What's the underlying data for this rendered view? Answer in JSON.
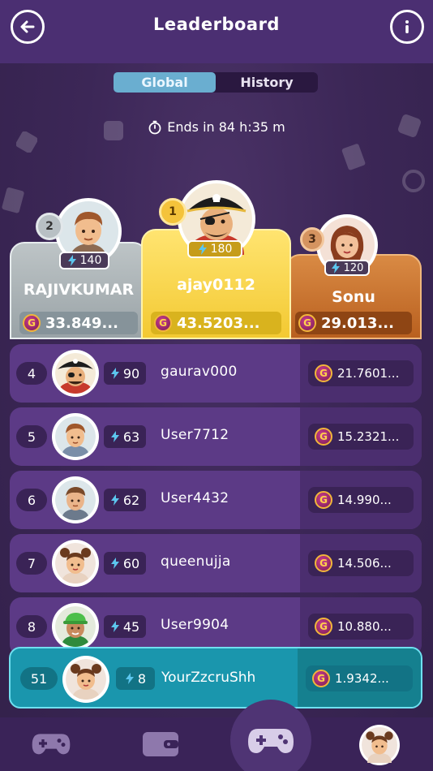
{
  "header": {
    "title": "Leaderboard"
  },
  "tabs": [
    {
      "label": "Global",
      "active": true
    },
    {
      "label": "History",
      "active": false
    }
  ],
  "timer": {
    "text": "Ends in 84 h:35 m"
  },
  "podium": {
    "first": {
      "rank": "1",
      "name": "ajay0112",
      "xp": "180",
      "score": "43.5203..."
    },
    "second": {
      "rank": "2",
      "name": "RAJIVKUMAR",
      "xp": "140",
      "score": "33.849..."
    },
    "third": {
      "rank": "3",
      "name": "Sonu",
      "xp": "120",
      "score": "29.013..."
    }
  },
  "list": [
    {
      "rank": "4",
      "xp": "90",
      "name": "gaurav000",
      "score": "21.7601...",
      "avatar": "pirate"
    },
    {
      "rank": "5",
      "xp": "63",
      "name": "User7712",
      "score": "15.2321...",
      "avatar": "boy"
    },
    {
      "rank": "6",
      "xp": "62",
      "name": "User4432",
      "score": "14.990...",
      "avatar": "boy2"
    },
    {
      "rank": "7",
      "xp": "60",
      "name": "queenujja",
      "score": "14.506...",
      "avatar": "girl"
    },
    {
      "rank": "8",
      "xp": "45",
      "name": "User9904",
      "score": "10.880...",
      "avatar": "cap"
    }
  ],
  "self": {
    "rank": "51",
    "xp": "8",
    "name": "YourZzcruShh",
    "score": "1.9342..."
  },
  "coin_letter": "G",
  "colors": {
    "accent": "#6aaed0",
    "self_row": "#1a96ad",
    "gold": "#f3c932",
    "silver": "#aab3b7",
    "bronze": "#c96e2c"
  }
}
